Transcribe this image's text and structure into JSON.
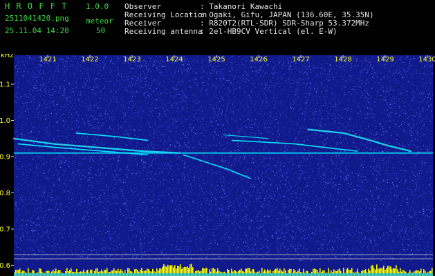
{
  "header": {
    "app_title": "HROFFT",
    "app_version": "1.0.0",
    "file_name": "2511041420.png",
    "meteor_label": "meteor",
    "date_time": "25.11.04 14:20",
    "meteor_count": "50",
    "info": [
      {
        "label": "Observer",
        "value": ": Takanori Kawachi"
      },
      {
        "label": "Receiving Location",
        "value": ": Ogaki, Gifu, JAPAN (136.60E, 35.35N)"
      },
      {
        "label": "Receiver",
        "value": ": R820T2(RTL-SDR) SDR-Sharp 53.372MHz"
      },
      {
        "label": "Receiving antenna",
        "value": ": 2el-HB9CV Vertical (el. E-W)"
      }
    ]
  },
  "colors": {
    "header_text": "#3ddc3d",
    "info_text": "#e8e8e8",
    "axis_text": "#ffff33",
    "background": "#000000",
    "noise": "#101a8a",
    "signal": "#00e5ff",
    "meteor_strong": "#ff6060",
    "bar": "#ffff00"
  },
  "chart_data": {
    "type": "heatmap",
    "y_unit": "kHz",
    "x_ticks": [
      "1421",
      "1422",
      "1423",
      "1424",
      "1425",
      "1426",
      "1427",
      "1428",
      "1429",
      "1430"
    ],
    "y_ticks": [
      "1.1",
      "1.0",
      "0.9",
      "0.8",
      "0.7",
      "0.6"
    ],
    "ylim": [
      0.58,
      1.18
    ],
    "x_range": [
      1420.6,
      1430.0
    ],
    "carrier_khz": 0.91,
    "echoes": [
      {
        "x": [
          1420.6,
          1421.5,
          1422.5,
          1423.5,
          1424.3
        ],
        "y": [
          0.95,
          0.935,
          0.925,
          0.915,
          0.91
        ],
        "strength": "strong"
      },
      {
        "x": [
          1420.7,
          1421.6,
          1422.6,
          1423.6
        ],
        "y": [
          0.935,
          0.925,
          0.915,
          0.905
        ],
        "strength": "medium"
      },
      {
        "x": [
          1422.0,
          1422.9,
          1423.6
        ],
        "y": [
          0.965,
          0.955,
          0.945
        ],
        "strength": "medium"
      },
      {
        "x": [
          1424.4,
          1424.9,
          1425.4,
          1425.9
        ],
        "y": [
          0.905,
          0.885,
          0.865,
          0.84
        ],
        "strength": "medium"
      },
      {
        "x": [
          1425.5,
          1426.2,
          1426.9,
          1427.6,
          1428.3
        ],
        "y": [
          0.945,
          0.94,
          0.935,
          0.925,
          0.915
        ],
        "strength": "medium"
      },
      {
        "x": [
          1427.2,
          1428.0,
          1428.6,
          1429.0,
          1429.5
        ],
        "y": [
          0.975,
          0.965,
          0.945,
          0.93,
          0.915
        ],
        "strength": "strong"
      },
      {
        "x": [
          1425.3,
          1425.8,
          1426.3
        ],
        "y": [
          0.96,
          0.955,
          0.95
        ],
        "strength": "weak"
      }
    ]
  }
}
